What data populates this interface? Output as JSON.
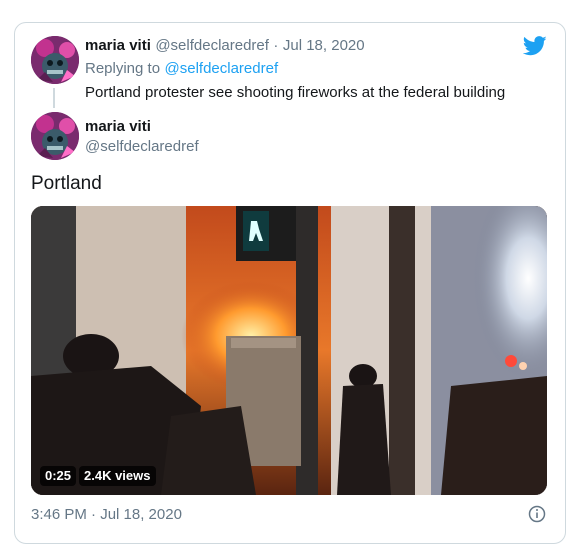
{
  "reply_tweet": {
    "author_name": "maria viti",
    "author_handle": "@selfdeclaredref",
    "separator": "·",
    "date": "Jul 18, 2020",
    "replying_prefix": "Replying to",
    "replying_to": "@selfdeclaredref",
    "text": "Portland protester see shooting fireworks at the federal building"
  },
  "main_tweet": {
    "author_name": "maria viti",
    "author_handle": "@selfdeclaredref",
    "text": "Portland",
    "video": {
      "duration": "0:25",
      "views": "2.4K views"
    },
    "timestamp": "3:46 PM · Jul 18, 2020"
  },
  "icons": {
    "brand": "twitter-bird-icon",
    "info": "info-icon"
  },
  "colors": {
    "brand_blue": "#1da1f2",
    "muted": "#657786",
    "border": "#cfd9de"
  }
}
